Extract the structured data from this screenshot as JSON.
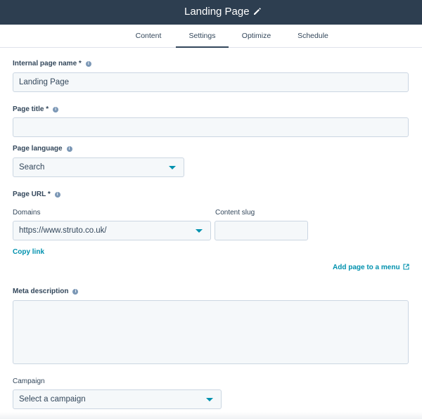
{
  "header": {
    "title": "Landing Page",
    "edit_icon": "pencil-icon"
  },
  "tabs": [
    {
      "label": "Content"
    },
    {
      "label": "Settings",
      "active": true
    },
    {
      "label": "Optimize"
    },
    {
      "label": "Schedule"
    }
  ],
  "form": {
    "internal_name": {
      "label": "Internal page name *",
      "value": "Landing Page"
    },
    "page_title": {
      "label": "Page title *",
      "value": ""
    },
    "page_language": {
      "label": "Page language",
      "value": "Search"
    },
    "page_url": {
      "label": "Page URL *",
      "domains_label": "Domains",
      "domain_value": "https://www.struto.co.uk/",
      "slug_label": "Content slug",
      "slug_value": "",
      "copy_link": "Copy link",
      "add_to_menu": "Add page to a menu"
    },
    "meta_description": {
      "label": "Meta description",
      "value": ""
    },
    "campaign": {
      "label": "Campaign",
      "value": "Select a campaign"
    }
  },
  "colors": {
    "header_bg": "#2d3e50",
    "accent": "#0091ae",
    "field_bg": "#f5f8fa",
    "text": "#33475b"
  }
}
